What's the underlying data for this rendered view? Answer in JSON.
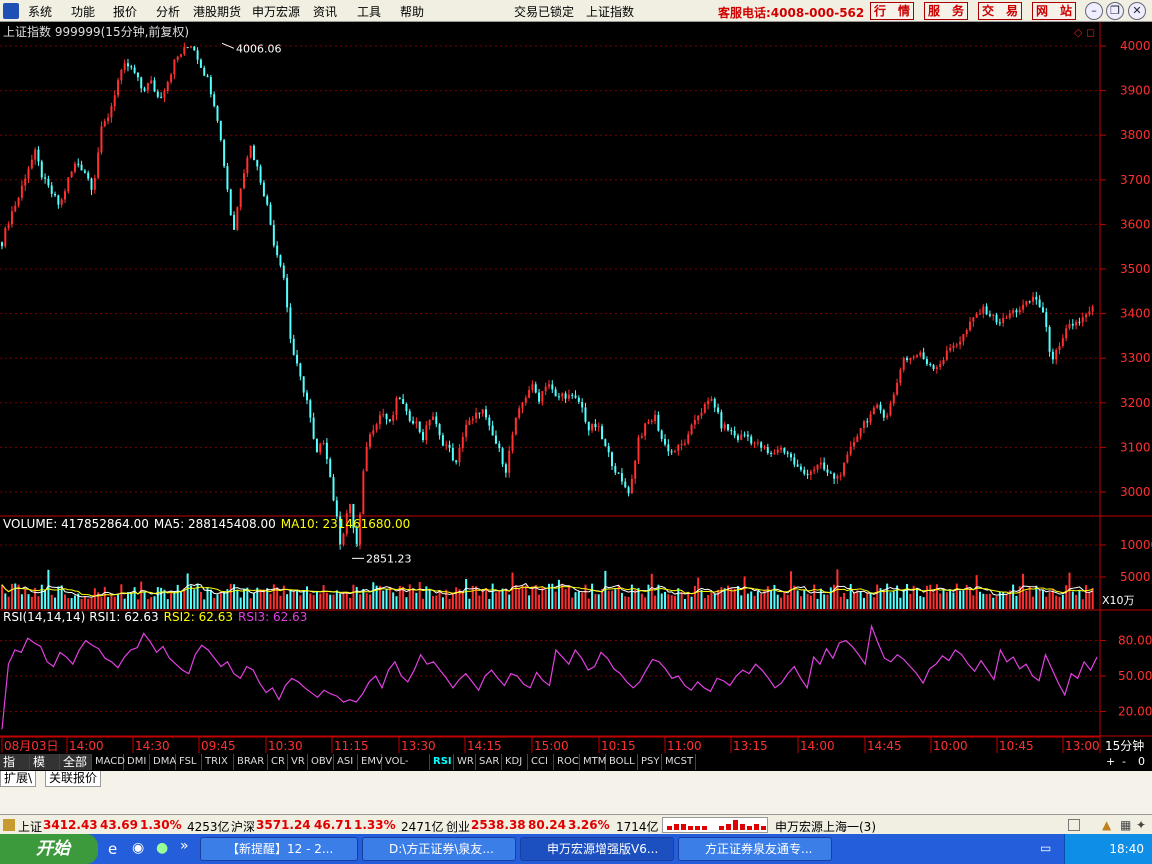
{
  "menu": {
    "items": [
      "系统",
      "功能",
      "报价",
      "分析",
      "港股期货",
      "申万宏源",
      "资讯",
      "工具",
      "帮助"
    ],
    "status": "交易已锁定",
    "current": "上证指数",
    "hotline": "客服电话:4008-000-562",
    "buttons": [
      "行　情",
      "服　务",
      "交　易",
      "网　站"
    ]
  },
  "header": {
    "title": "上证指数 999999(15分钟,前复权)"
  },
  "chart_data": [
    {
      "type": "candlestick",
      "title": "上证指数 999999(15分钟,前复权)",
      "y_ticks": [
        4000,
        3900,
        3800,
        3700,
        3600,
        3500,
        3400,
        3300,
        3200,
        3100,
        3000
      ],
      "ylim": [
        2830,
        4020
      ],
      "x_labels": [
        "08月03日",
        "14:00",
        "14:30",
        "09:45",
        "10:30",
        "11:15",
        "13:30",
        "14:15",
        "15:00",
        "10:15",
        "11:00",
        "13:15",
        "14:00",
        "14:45",
        "10:00",
        "10:45",
        "13:00"
      ],
      "annotations": [
        {
          "text": "4006.06",
          "value": 4006.06
        },
        {
          "text": "2851.23",
          "value": 2851.23
        }
      ],
      "close_path": [
        3560,
        3620,
        3660,
        3720,
        3760,
        3700,
        3670,
        3640,
        3700,
        3740,
        3720,
        3680,
        3810,
        3850,
        3920,
        3960,
        3940,
        3900,
        3920,
        3880,
        3920,
        3970,
        3990,
        4006,
        3960,
        3920,
        3850,
        3720,
        3580,
        3700,
        3780,
        3720,
        3650,
        3550,
        3500,
        3330,
        3260,
        3200,
        3080,
        3120,
        3000,
        2880,
        2980,
        2870,
        3100,
        3150,
        3180,
        3150,
        3220,
        3170,
        3160,
        3120,
        3180,
        3120,
        3100,
        3060,
        3150,
        3160,
        3190,
        3140,
        3100,
        3050,
        3150,
        3200,
        3240,
        3210,
        3250,
        3210,
        3220,
        3210,
        3200,
        3140,
        3150,
        3100,
        3060,
        3020,
        3000,
        3120,
        3150,
        3170,
        3110,
        3090,
        3100,
        3120,
        3170,
        3190,
        3210,
        3150,
        3140,
        3120,
        3130,
        3110,
        3100,
        3080,
        3100,
        3090,
        3060,
        3040,
        3050,
        3060,
        3040,
        3030,
        3060,
        3110,
        3150,
        3170,
        3190,
        3170,
        3220,
        3300,
        3300,
        3310,
        3290,
        3280,
        3300,
        3330,
        3340,
        3370,
        3400,
        3410,
        3390,
        3380,
        3400,
        3410,
        3420,
        3440,
        3400,
        3300,
        3320,
        3370,
        3380,
        3390,
        3410
      ]
    },
    {
      "type": "bar",
      "title": "VOLUME: 417852864.00",
      "series": [
        {
          "name": "MA5: 288145408.00"
        },
        {
          "name": "MA10: 231461680.00"
        }
      ],
      "y_ticks": [
        10000,
        5000
      ],
      "unit": "X10万"
    },
    {
      "type": "line",
      "title": "RSI(14,14,14)",
      "series": [
        {
          "name": "RSI1: 62.63"
        },
        {
          "name": "RSI2: 62.63"
        },
        {
          "name": "RSI3: 62.63"
        }
      ],
      "y_ticks": [
        80,
        50,
        20
      ],
      "ylim": [
        5,
        95
      ],
      "values": [
        5,
        60,
        72,
        70,
        82,
        78,
        75,
        62,
        58,
        70,
        66,
        60,
        72,
        80,
        76,
        73,
        65,
        62,
        57,
        66,
        72,
        74,
        86,
        79,
        70,
        75,
        65,
        60,
        55,
        52,
        68,
        76,
        72,
        65,
        58,
        62,
        52,
        48,
        58,
        55,
        44,
        36,
        40,
        30,
        42,
        48,
        45,
        40,
        36,
        32,
        38,
        35,
        33,
        28,
        30,
        28,
        35,
        45,
        50,
        40,
        55,
        62,
        50,
        45,
        55,
        68,
        60,
        62,
        55,
        48,
        40,
        47,
        52,
        45,
        38,
        50,
        55,
        48,
        42,
        52,
        50,
        43,
        40,
        53,
        46,
        42,
        72,
        66,
        60,
        72,
        65,
        55,
        58,
        70,
        65,
        56,
        52,
        45,
        40,
        45,
        55,
        64,
        62,
        56,
        48,
        50,
        42,
        38,
        45,
        40,
        37,
        48,
        46,
        42,
        50,
        55,
        52,
        60,
        55,
        48,
        40,
        44,
        52,
        58,
        48,
        40,
        66,
        60,
        73,
        65,
        78,
        80,
        75,
        68,
        60,
        92,
        78,
        65,
        62,
        68,
        64,
        58,
        52,
        44,
        56,
        60,
        67,
        63,
        72,
        68,
        60,
        54,
        63,
        55,
        47,
        72,
        62,
        66,
        56,
        60,
        50,
        46,
        68,
        56,
        44,
        34,
        52,
        48,
        62,
        55,
        66
      ]
    }
  ],
  "time_axis": {
    "period": "15分钟",
    "controls": [
      "+",
      "-",
      "0"
    ]
  },
  "indicator_tabs": [
    "指标",
    "模板",
    "全部",
    "MACD",
    "DMI",
    "DMA",
    "FSL",
    "TRIX",
    "BRAR",
    "CR",
    "VR",
    "OBV",
    "ASI",
    "EMV",
    "VOL-TDX",
    "RSI",
    "WR",
    "SAR",
    "KDJ",
    "CCI",
    "ROC",
    "MTM",
    "BOLL",
    "PSY",
    "MCST"
  ],
  "active_tab": "RSI",
  "lower_tabs": [
    "扩展\\",
    "关联报价"
  ],
  "status": {
    "sh_label": "上证",
    "sh_value": "3412.43",
    "sh_change": "43.69",
    "sh_pct": "1.30%",
    "sh_amount": "4253亿",
    "hs_label": "沪深",
    "hs_value": "3571.24",
    "hs_change": "46.71",
    "hs_pct": "1.33%",
    "hs_amount": "2471亿",
    "cy_label": "创业",
    "cy_value": "2538.38",
    "cy_change": "80.24",
    "cy_pct": "3.26%",
    "cy_amount": "1714亿",
    "broker": "申万宏源上海一(3)"
  },
  "taskbar": {
    "start": "开始",
    "tasks": [
      "【新提醒】12 - 2...",
      "D:\\方正证券\\泉友...",
      "申万宏源增强版V6...",
      "方正证券泉友通专..."
    ],
    "time": "18:40"
  },
  "colors": {
    "up": "#ff3030",
    "down": "#54ffff",
    "grid": "#7a0000",
    "axis": "#c00000",
    "rsi": "#e040e0",
    "ma5": "#ffffff",
    "ma10": "#ffff00"
  }
}
